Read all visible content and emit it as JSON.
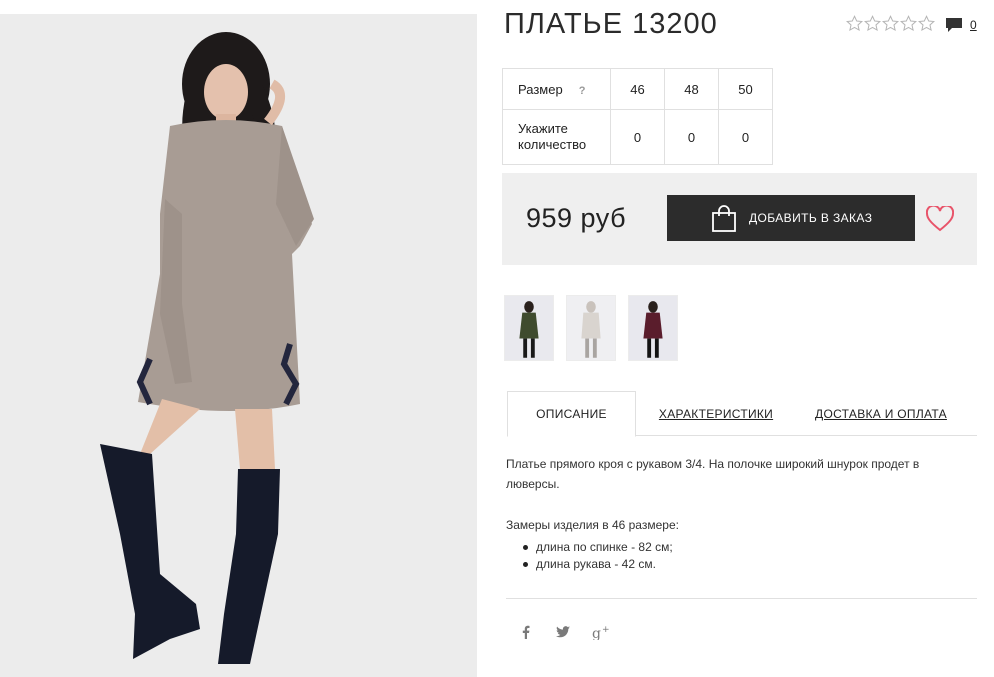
{
  "product": {
    "title": "ПЛАТЬЕ 13200",
    "rating_stars": 0,
    "rating_max": 5,
    "comments_count": "0"
  },
  "size_table": {
    "size_label": "Размер",
    "help_mark": "?",
    "qty_label": "Укажите количество",
    "sizes": [
      "46",
      "48",
      "50"
    ],
    "quantities": [
      "0",
      "0",
      "0"
    ]
  },
  "purchase": {
    "price": "959 руб",
    "add_button_label": "ДОБАВИТЬ В ЗАКАЗ"
  },
  "colors": {
    "accent": "#e8546a",
    "button_bg": "#2c2c2c",
    "price_panel_bg": "#efefef",
    "thumb_colors": [
      "#3f4b2e",
      "#d9d4cf",
      "#5a1d2c"
    ]
  },
  "thumbnails": [
    {
      "name": "dress-olive"
    },
    {
      "name": "dress-light-grey"
    },
    {
      "name": "dress-burgundy"
    }
  ],
  "tabs": [
    {
      "label": "ОПИСАНИЕ",
      "active": true
    },
    {
      "label": "ХАРАКТЕРИСТИКИ",
      "active": false
    },
    {
      "label": "ДОСТАВКА И ОПЛАТА",
      "active": false
    }
  ],
  "description": {
    "text": "Платье прямого кроя с рукавом 3/4. На полочке широкий шнурок продет в люверсы.",
    "measurements_title": "Замеры изделия в 46 размере:",
    "measurements": [
      "длина по спинке - 82 см;",
      "длина рукава - 42 см."
    ]
  },
  "social": [
    "facebook-icon",
    "twitter-icon",
    "google-plus-icon"
  ]
}
